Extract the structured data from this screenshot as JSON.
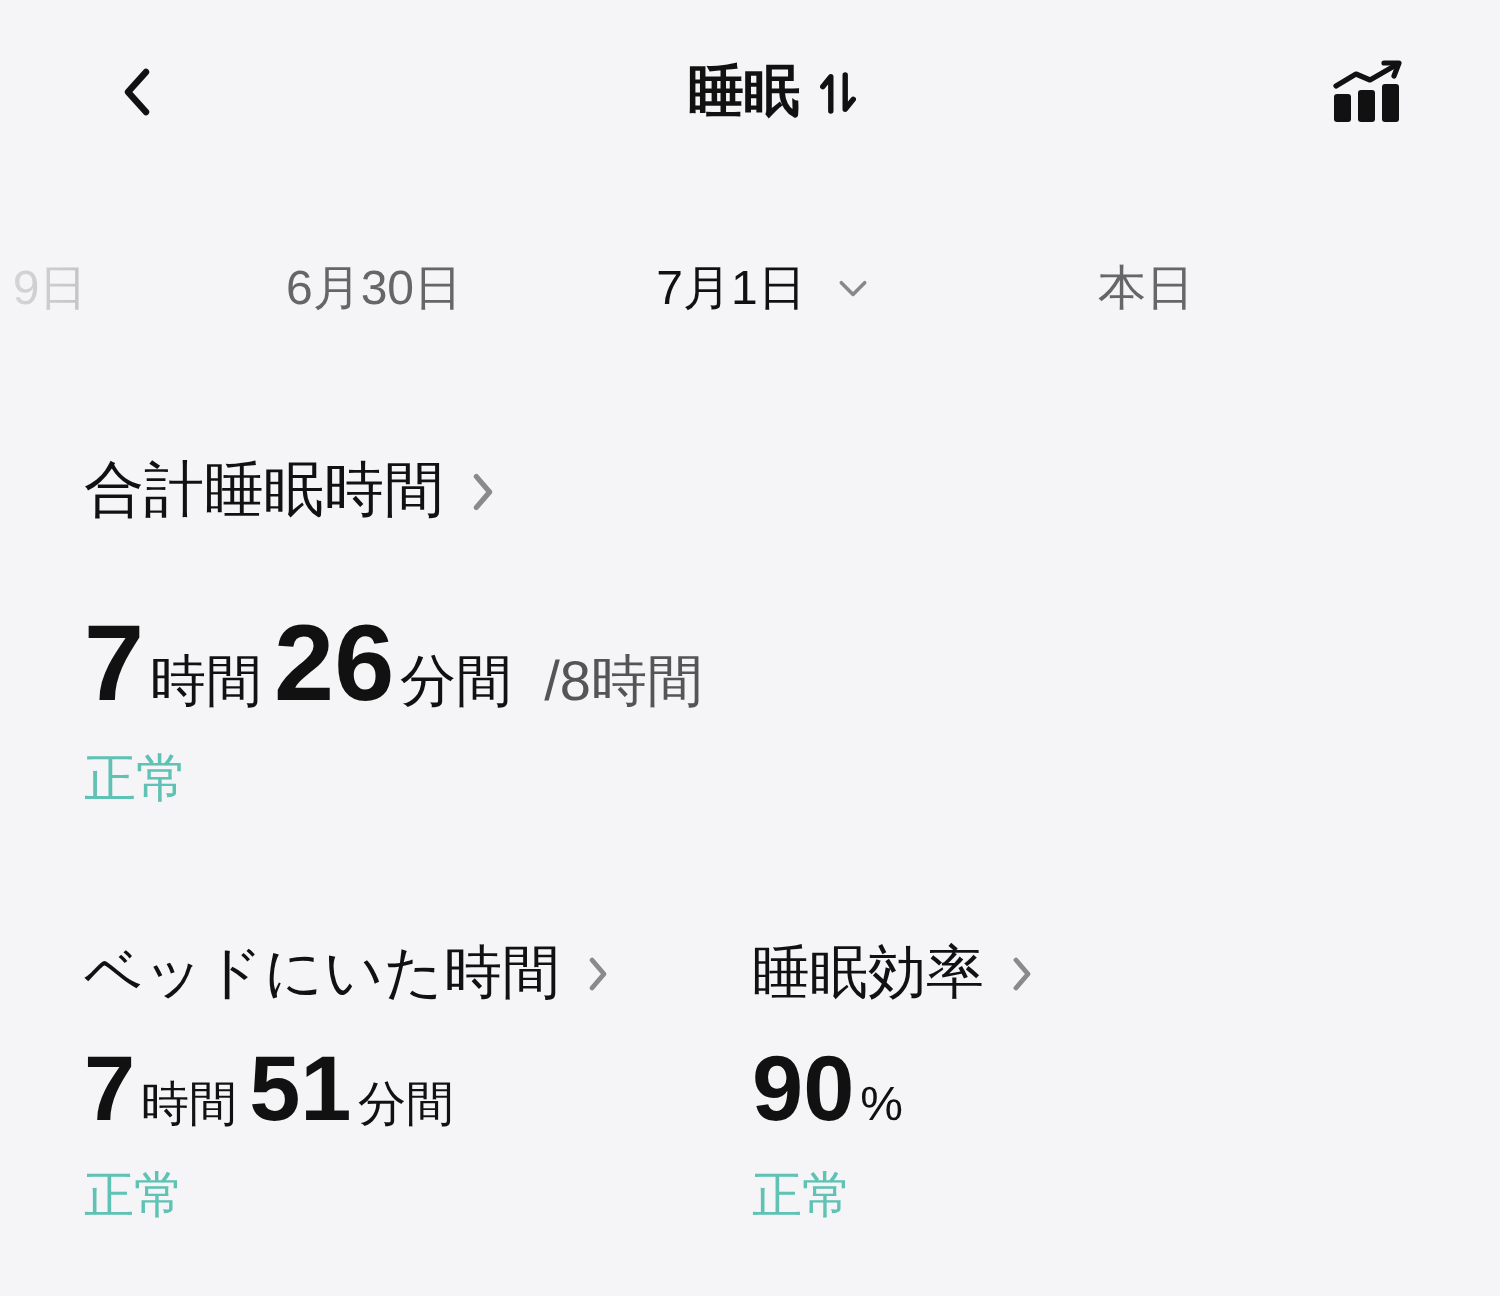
{
  "header": {
    "title": "睡眠"
  },
  "date_tabs": [
    {
      "label": "9日",
      "selected": false
    },
    {
      "label": "6月30日",
      "selected": false
    },
    {
      "label": "7月1日",
      "selected": true
    },
    {
      "label": "本日",
      "selected": false
    }
  ],
  "total_sleep": {
    "title": "合計睡眠時間",
    "value": [
      {
        "kind": "number",
        "text": "7"
      },
      {
        "kind": "unit",
        "text": "時間"
      },
      {
        "kind": "number",
        "text": "26"
      },
      {
        "kind": "unit",
        "text": "分間"
      }
    ],
    "goal": "/8時間",
    "status": "正常"
  },
  "metrics": [
    {
      "title": "ベッドにいた時間",
      "value": [
        {
          "kind": "number",
          "text": "7"
        },
        {
          "kind": "unit",
          "text": "時間"
        },
        {
          "kind": "number",
          "text": "51"
        },
        {
          "kind": "unit",
          "text": "分間"
        }
      ],
      "status": "正常"
    },
    {
      "title": "睡眠効率",
      "value": [
        {
          "kind": "number",
          "text": "90"
        },
        {
          "kind": "unit",
          "text": "%"
        }
      ],
      "status": "正常"
    }
  ]
}
